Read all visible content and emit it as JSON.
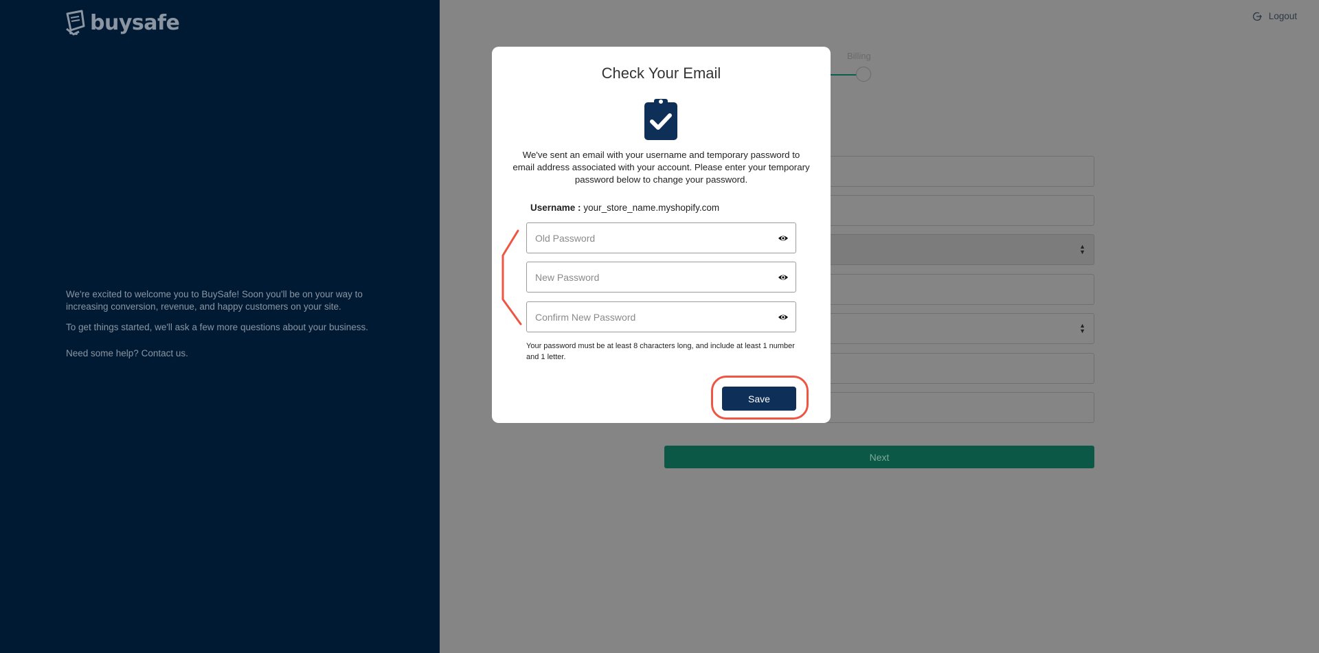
{
  "app": {
    "brand": "buysafe"
  },
  "left_panel": {
    "welcome_line1": "We're excited to welcome you to BuySafe! Soon you'll be on your way to increasing conversion, revenue, and happy customers on your site.",
    "welcome_line2": "To get things started, we'll ask a few more questions about your business.",
    "help_text": "Need some help? Contact us."
  },
  "header": {
    "logout_label": "Logout"
  },
  "stepper": {
    "step_label": "Billing"
  },
  "background_form": {
    "next_label": "Next"
  },
  "modal": {
    "title": "Check Your Email",
    "message": "We've sent an email with your username and temporary password to email address associated with your account. Please enter your temporary password below to change your password.",
    "username_label": "Username :",
    "username_value": "your_store_name.myshopify.com",
    "old_password_placeholder": "Old Password",
    "new_password_placeholder": "New Password",
    "confirm_password_placeholder": "Confirm New Password",
    "password_hint": "Your password must be at least 8 characters long, and include at least 1 number and 1 letter.",
    "save_label": "Save"
  },
  "colors": {
    "left_panel_bg": "#011a33",
    "overlay_bg": "#858585",
    "primary_button": "#0d2f58",
    "next_button": "#0b5846",
    "annotation": "#ee5542"
  }
}
